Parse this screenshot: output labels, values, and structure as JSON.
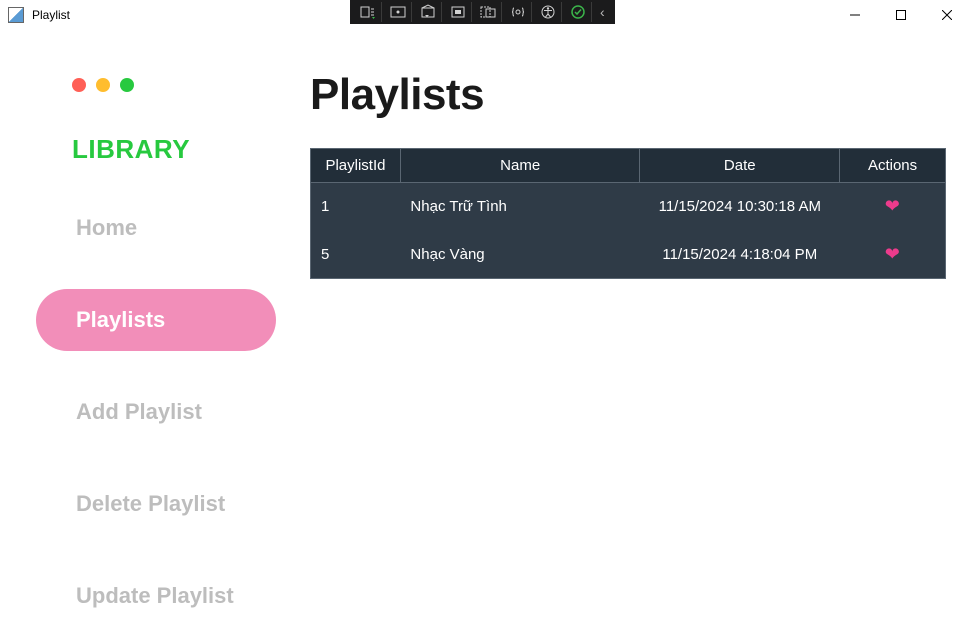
{
  "titlebar": {
    "title": "Playlist"
  },
  "sidebar": {
    "heading": "LIBRARY",
    "items": [
      {
        "label": "Home",
        "active": false
      },
      {
        "label": "Playlists",
        "active": true
      },
      {
        "label": "Add Playlist",
        "active": false
      },
      {
        "label": "Delete Playlist",
        "active": false
      },
      {
        "label": "Update Playlist",
        "active": false
      }
    ]
  },
  "page": {
    "title": "Playlists"
  },
  "table": {
    "headers": {
      "id": "PlaylistId",
      "name": "Name",
      "date": "Date",
      "actions": "Actions"
    },
    "rows": [
      {
        "id": "1",
        "name": "Nhạc Trữ Tình",
        "date": "11/15/2024 10:30:18 AM"
      },
      {
        "id": "5",
        "name": "Nhạc Vàng",
        "date": "11/15/2024 4:18:04 PM"
      }
    ]
  }
}
